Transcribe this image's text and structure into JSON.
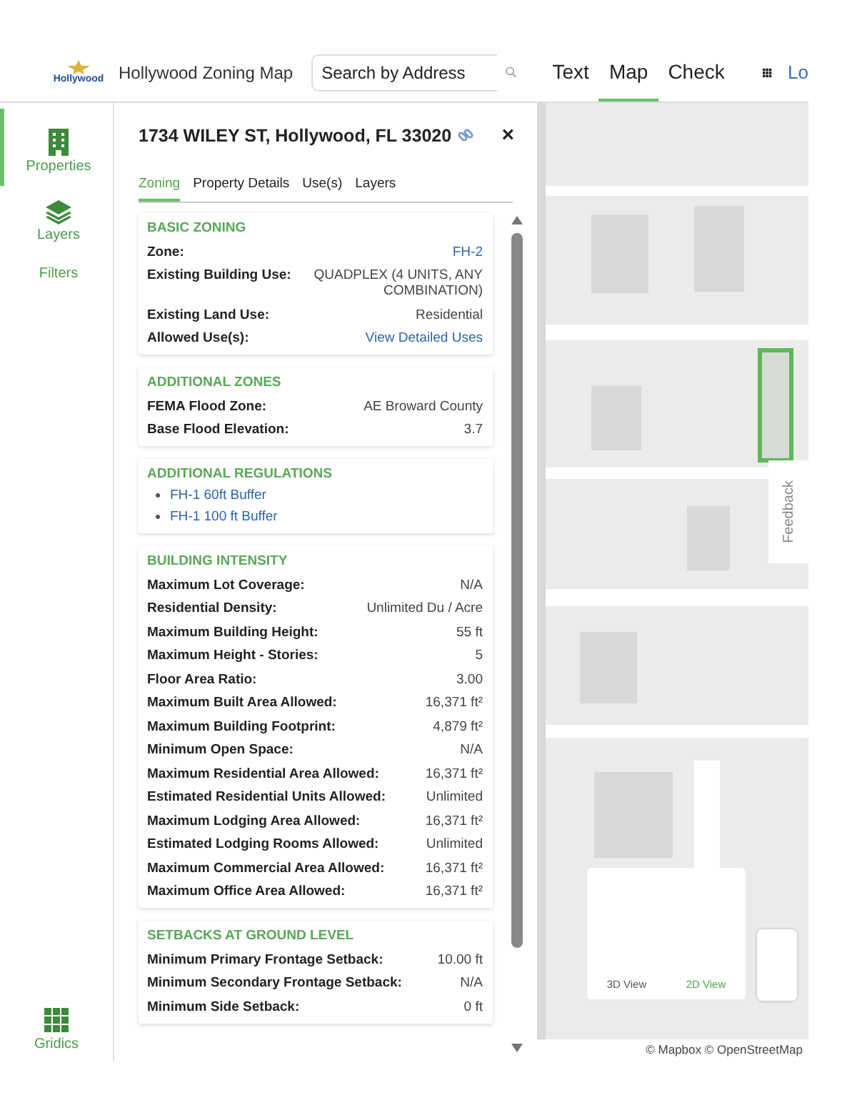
{
  "header": {
    "logo_text": "Hollywood",
    "title": "Hollywood Zoning Map",
    "search": {
      "placeholder": "Search by Address"
    },
    "nav": [
      {
        "label": "Text",
        "selected": false
      },
      {
        "label": "Map",
        "selected": true
      },
      {
        "label": "Check",
        "selected": false
      }
    ],
    "login": "Lo"
  },
  "sidebar": {
    "items": [
      {
        "label": "Properties",
        "selected": true
      },
      {
        "label": "Layers",
        "selected": false
      },
      {
        "label": "Filters",
        "selected": false
      }
    ],
    "footer": "Gridics"
  },
  "panel": {
    "title": "1734 WILEY ST, Hollywood, FL 33020",
    "close": "×",
    "tabs": [
      {
        "label": "Zoning",
        "selected": true
      },
      {
        "label": "Property Details",
        "selected": false
      },
      {
        "label": "Use(s)",
        "selected": false
      },
      {
        "label": "Layers",
        "selected": false
      }
    ],
    "sections": [
      {
        "title": "BASIC ZONING",
        "kind": "rows",
        "rows": [
          {
            "label": "Zone:",
            "value": "FH-2",
            "link": true
          },
          {
            "label": "Existing Building Use:",
            "value": "QUADPLEX (4 UNITS, ANY COMBINATION)",
            "link": false
          },
          {
            "label": "Existing Land Use:",
            "value": "Residential",
            "link": false
          },
          {
            "label": "Allowed Use(s):",
            "value": "View Detailed Uses",
            "link": true
          }
        ]
      },
      {
        "title": "ADDITIONAL ZONES",
        "kind": "rows",
        "rows": [
          {
            "label": "FEMA Flood Zone:",
            "value": "AE Broward County",
            "link": false
          },
          {
            "label": "Base Flood Elevation:",
            "value": "3.7",
            "link": false
          }
        ]
      },
      {
        "title": "ADDITIONAL REGULATIONS",
        "kind": "links",
        "items": [
          "FH-1 60ft Buffer",
          "FH-1 100 ft Buffer"
        ]
      },
      {
        "title": "BUILDING INTENSITY",
        "kind": "rows",
        "rows": [
          {
            "label": "Maximum Lot Coverage:",
            "value": "N/A",
            "link": false
          },
          {
            "label": "Residential Density:",
            "value": "Unlimited Du / Acre",
            "link": false
          },
          {
            "label": "Maximum Building Height:",
            "value": "55 ft",
            "link": false
          },
          {
            "label": "Maximum Height - Stories:",
            "value": "5",
            "link": false
          },
          {
            "label": "Floor Area Ratio:",
            "value": "3.00",
            "link": false
          },
          {
            "label": "Maximum Built Area Allowed:",
            "value": "16,371 ft²",
            "link": false
          },
          {
            "label": "Maximum Building Footprint:",
            "value": "4,879 ft²",
            "link": false
          },
          {
            "label": "Minimum Open Space:",
            "value": "N/A",
            "link": false
          },
          {
            "label": "Maximum Residential Area Allowed:",
            "value": "16,371 ft²",
            "link": false
          },
          {
            "label": "Estimated Residential Units Allowed:",
            "value": "Unlimited",
            "link": false
          },
          {
            "label": "Maximum Lodging Area Allowed:",
            "value": "16,371 ft²",
            "link": false
          },
          {
            "label": "Estimated Lodging Rooms Allowed:",
            "value": "Unlimited",
            "link": false
          },
          {
            "label": "Maximum Commercial Area Allowed:",
            "value": "16,371 ft²",
            "link": false
          },
          {
            "label": "Maximum Office Area Allowed:",
            "value": "16,371 ft²",
            "link": false
          }
        ]
      },
      {
        "title": "SETBACKS AT GROUND LEVEL",
        "kind": "rows",
        "rows": [
          {
            "label": "Minimum Primary Frontage Setback:",
            "value": "10.00 ft",
            "link": false
          },
          {
            "label": "Minimum Secondary Frontage Setback:",
            "value": "N/A",
            "link": false
          },
          {
            "label": "Minimum Side Setback:",
            "value": "0 ft",
            "link": false
          }
        ]
      }
    ]
  },
  "map": {
    "kind": "picture",
    "feedback": "Feedback",
    "views": [
      {
        "label": "3D View",
        "selected": false
      },
      {
        "label": "2D View",
        "selected": true
      }
    ],
    "attribution": "© Mapbox © OpenStreetMap"
  }
}
